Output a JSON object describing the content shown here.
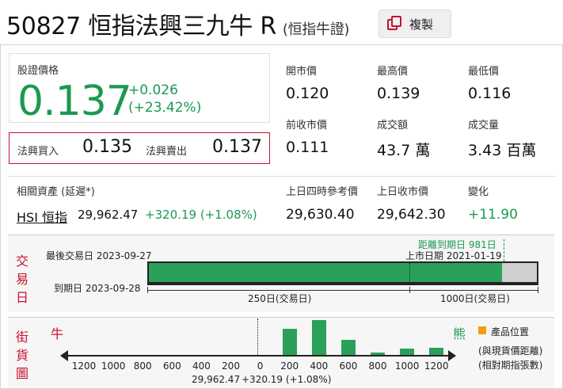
{
  "header": {
    "code": "50827",
    "name": "恒指法興三九牛 R",
    "subtitle": "(恒指牛證)",
    "copy_label": "複製"
  },
  "quote": {
    "price_label": "股證價格",
    "price": "0.137",
    "change": "+0.026",
    "change_pct": "(+23.42%)",
    "bid_label": "法興買入",
    "bid": "0.135",
    "ask_label": "法興賣出",
    "ask": "0.137"
  },
  "stats": {
    "open_label": "開市價",
    "open": "0.120",
    "high_label": "最高價",
    "high": "0.139",
    "low_label": "最低價",
    "low": "0.116",
    "prev_close_label": "前收市價",
    "prev_close": "0.111",
    "turnover_label": "成交額",
    "turnover": "43.7 萬",
    "volume_label": "成交量",
    "volume": "3.43 百萬"
  },
  "underlying": {
    "label": "相關資產 (延遲*)",
    "name": "HSI 恒指",
    "price": "29,962.47",
    "change": "+320.19 (+1.08%)",
    "ref_label": "上日四時參考價",
    "ref": "29,630.40",
    "prev_close_label": "上日收市價",
    "prev_close": "29,642.30",
    "diff_label": "變化",
    "diff": "+11.90"
  },
  "trading_days": {
    "section_label": [
      "交",
      "易",
      "日"
    ],
    "last_trade": "最後交易日 2023-09-27",
    "expiry": "到期日 2023-09-28",
    "days_to_expiry": "距離到期日 981日",
    "listing": "上市日期 2021-01-19",
    "remaining_label": "250日(交易日)",
    "total_label": "1000日(交易日)",
    "elapsed_fraction": 0.91
  },
  "street": {
    "section_label": [
      "街",
      "貨",
      "圖"
    ],
    "bull_label": "牛",
    "bear_label": "熊",
    "legend_label": "產品位置",
    "note1": "(與現貨價距離)",
    "note2": "(相對期指張數)",
    "spot_caption": "29,962.47",
    "spot_change": "+320.19 (+1.08%)",
    "ticks": [
      "1200",
      "1000",
      "800",
      "600",
      "400",
      "200",
      "0",
      "200",
      "400",
      "600",
      "800",
      "1000",
      "1200"
    ],
    "colors": {
      "bar": "#2aa05a",
      "legend": "#f39c12",
      "accent": "#c8102e"
    }
  },
  "chart_data": {
    "type": "bar",
    "categories": [
      "200",
      "400",
      "600",
      "800",
      "1000",
      "1200"
    ],
    "values": [
      36,
      48,
      21,
      3,
      9,
      10
    ],
    "xlabel": "",
    "ylabel": ""
  }
}
